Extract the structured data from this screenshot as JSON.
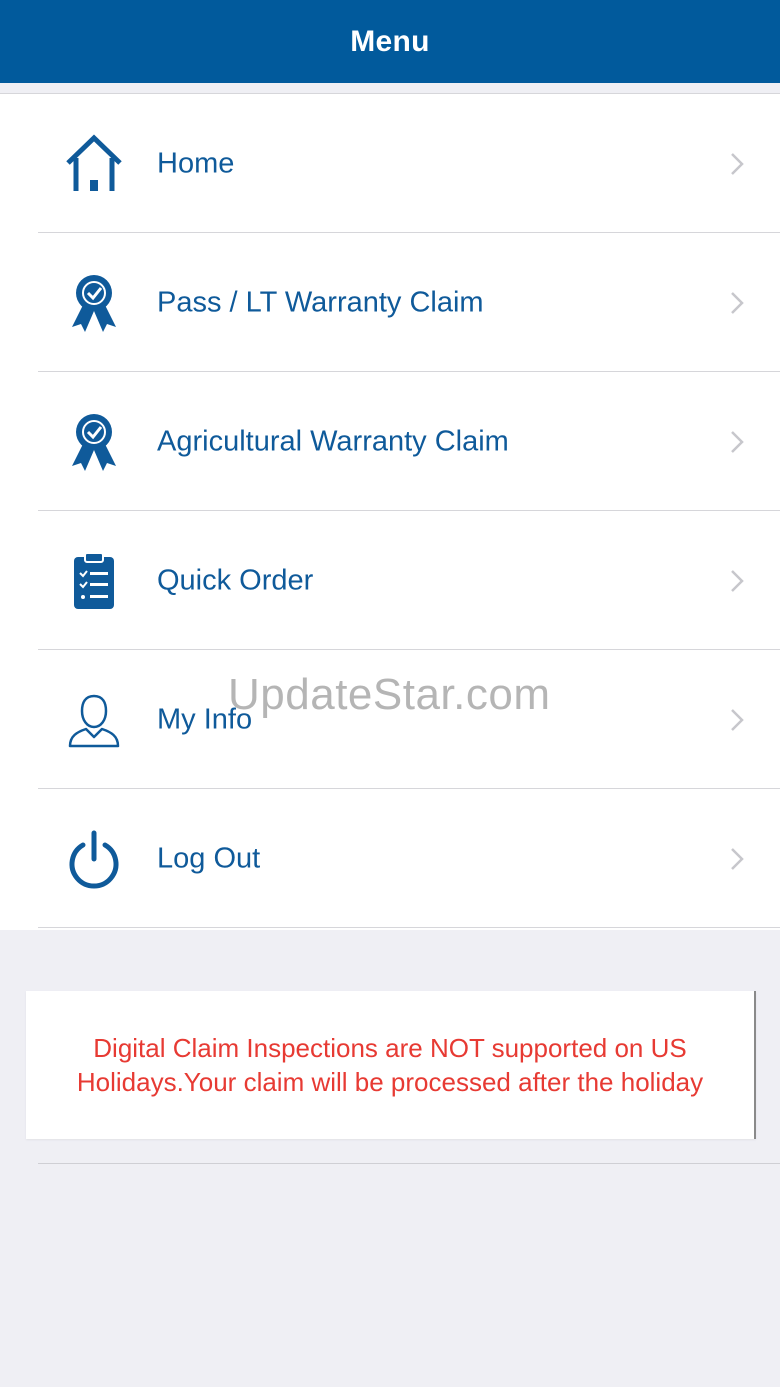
{
  "header": {
    "title": "Menu"
  },
  "menu": {
    "items": [
      {
        "label": "Home",
        "icon": "home-icon",
        "name": "menu-item-home"
      },
      {
        "label": "Pass / LT Warranty Claim",
        "icon": "award-ribbon-icon",
        "name": "menu-item-pass-lt-warranty-claim"
      },
      {
        "label": "Agricultural Warranty Claim",
        "icon": "award-ribbon-icon",
        "name": "menu-item-agricultural-warranty-claim"
      },
      {
        "label": "Quick Order",
        "icon": "clipboard-checklist-icon",
        "name": "menu-item-quick-order"
      },
      {
        "label": "My Info",
        "icon": "user-icon",
        "name": "menu-item-my-info"
      },
      {
        "label": "Log Out",
        "icon": "power-icon",
        "name": "menu-item-log-out"
      }
    ]
  },
  "notice": {
    "text": "Digital Claim Inspections are NOT supported on US Holidays.Your claim will be processed after the holiday"
  },
  "watermark": {
    "text": "UpdateStar.com"
  },
  "colors": {
    "brand": "#015a9c",
    "label": "#0f5a9a",
    "warning": "#e73a33",
    "background": "#efeff4"
  }
}
